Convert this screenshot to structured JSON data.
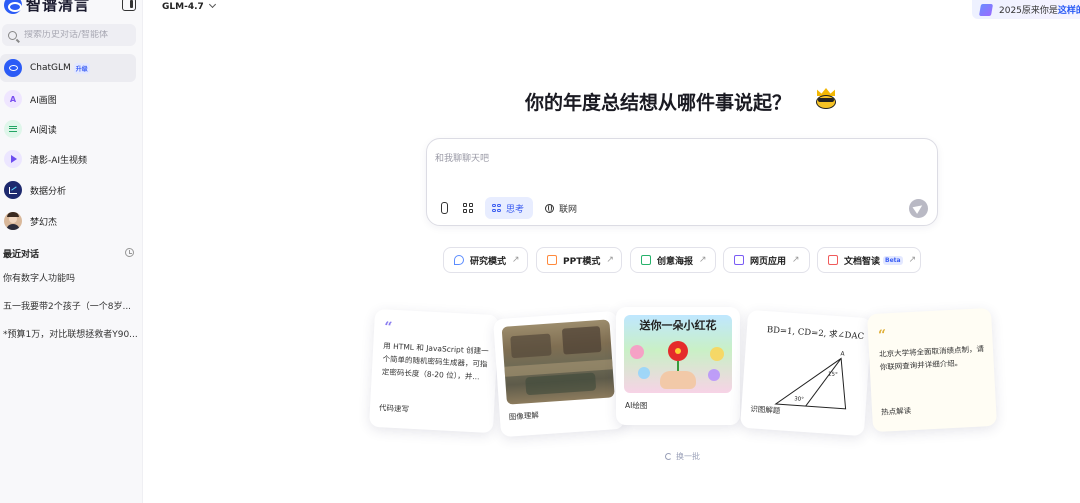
{
  "app": {
    "logo_text": "智谱清言",
    "model_label": "GLM-4.7",
    "promo_text": "2025原来你是",
    "promo_link": "这样的"
  },
  "sidebar": {
    "search_placeholder": "搜索历史对话/智能体",
    "items": [
      {
        "label": "ChatGLM",
        "badge": "升级",
        "icon": "chatglm-logo-icon"
      },
      {
        "label": "AI画图",
        "icon": "ai-draw-icon"
      },
      {
        "label": "AI阅读",
        "icon": "ai-read-icon"
      },
      {
        "label": "清影-AI生视频",
        "icon": "video-play-icon"
      },
      {
        "label": "数据分析",
        "icon": "chart-icon"
      },
      {
        "label": "梦幻杰",
        "icon": "avatar-icon"
      }
    ],
    "recent_title": "最近对话",
    "recent": [
      "你有数字人功能吗",
      "五一我要带2个孩子（一个8岁...",
      "*预算1万，对比联想拯救者Y90..."
    ]
  },
  "main": {
    "headline": "你的年度总结想从哪件事说起？",
    "input_placeholder": "和我聊聊天吧",
    "think_label": "思考",
    "web_label": "联网",
    "chips": [
      {
        "label": "研究模式",
        "color": "#5b8cff"
      },
      {
        "label": "PPT模式",
        "color": "#ff8a3d"
      },
      {
        "label": "创意海报",
        "color": "#27b26b"
      },
      {
        "label": "网页应用",
        "color": "#7a5cf5"
      },
      {
        "label": "文档智读",
        "badge": "Beta",
        "color": "#f05b5b"
      }
    ],
    "cards": [
      {
        "label": "代码速写",
        "text": "用 HTML 和 JavaScript 创建一个简单的随机密码生成器，可指定密码长度（8-20 位），并..."
      },
      {
        "label": "图像理解"
      },
      {
        "label": "AI绘图",
        "image_text": "送你一朵小红花"
      },
      {
        "label": "识图解题",
        "problem": "BD=1, CD=2, 求∠DAC",
        "point_a": "A",
        "angle_1": "15°",
        "angle_2": "30°"
      },
      {
        "label": "热点解读",
        "text": "北京大学将全面取消绩点制，请你联网查询并详细介绍。"
      }
    ],
    "refresh_label": "换一批"
  }
}
